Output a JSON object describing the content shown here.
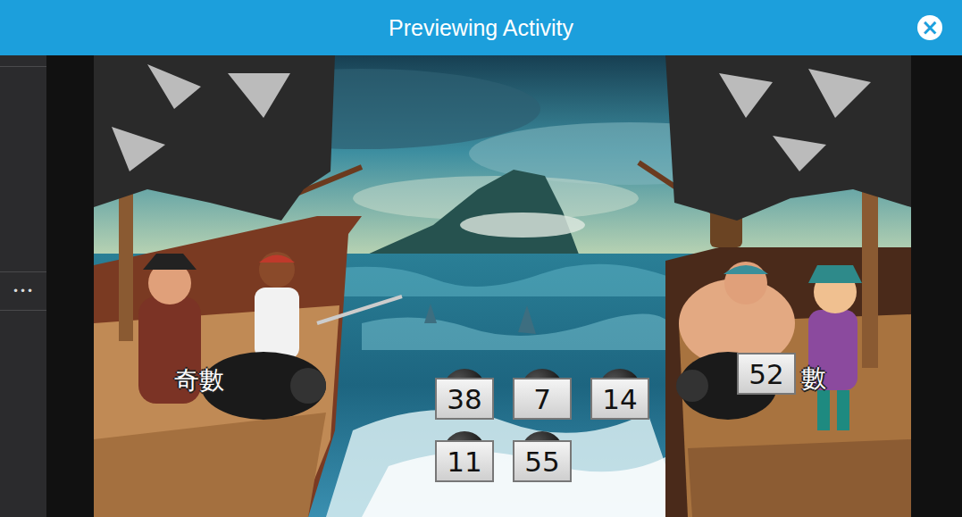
{
  "window": {
    "title": "Previewing Activity",
    "close": "×"
  },
  "sidebar": {
    "more": "•••"
  },
  "game": {
    "ships": [
      {
        "label": "奇數"
      },
      {
        "label": "數"
      }
    ],
    "tiles": [
      {
        "value": "38"
      },
      {
        "value": "7"
      },
      {
        "value": "14"
      },
      {
        "value": "11"
      },
      {
        "value": "55"
      }
    ],
    "held_tile": {
      "value": "52"
    }
  }
}
